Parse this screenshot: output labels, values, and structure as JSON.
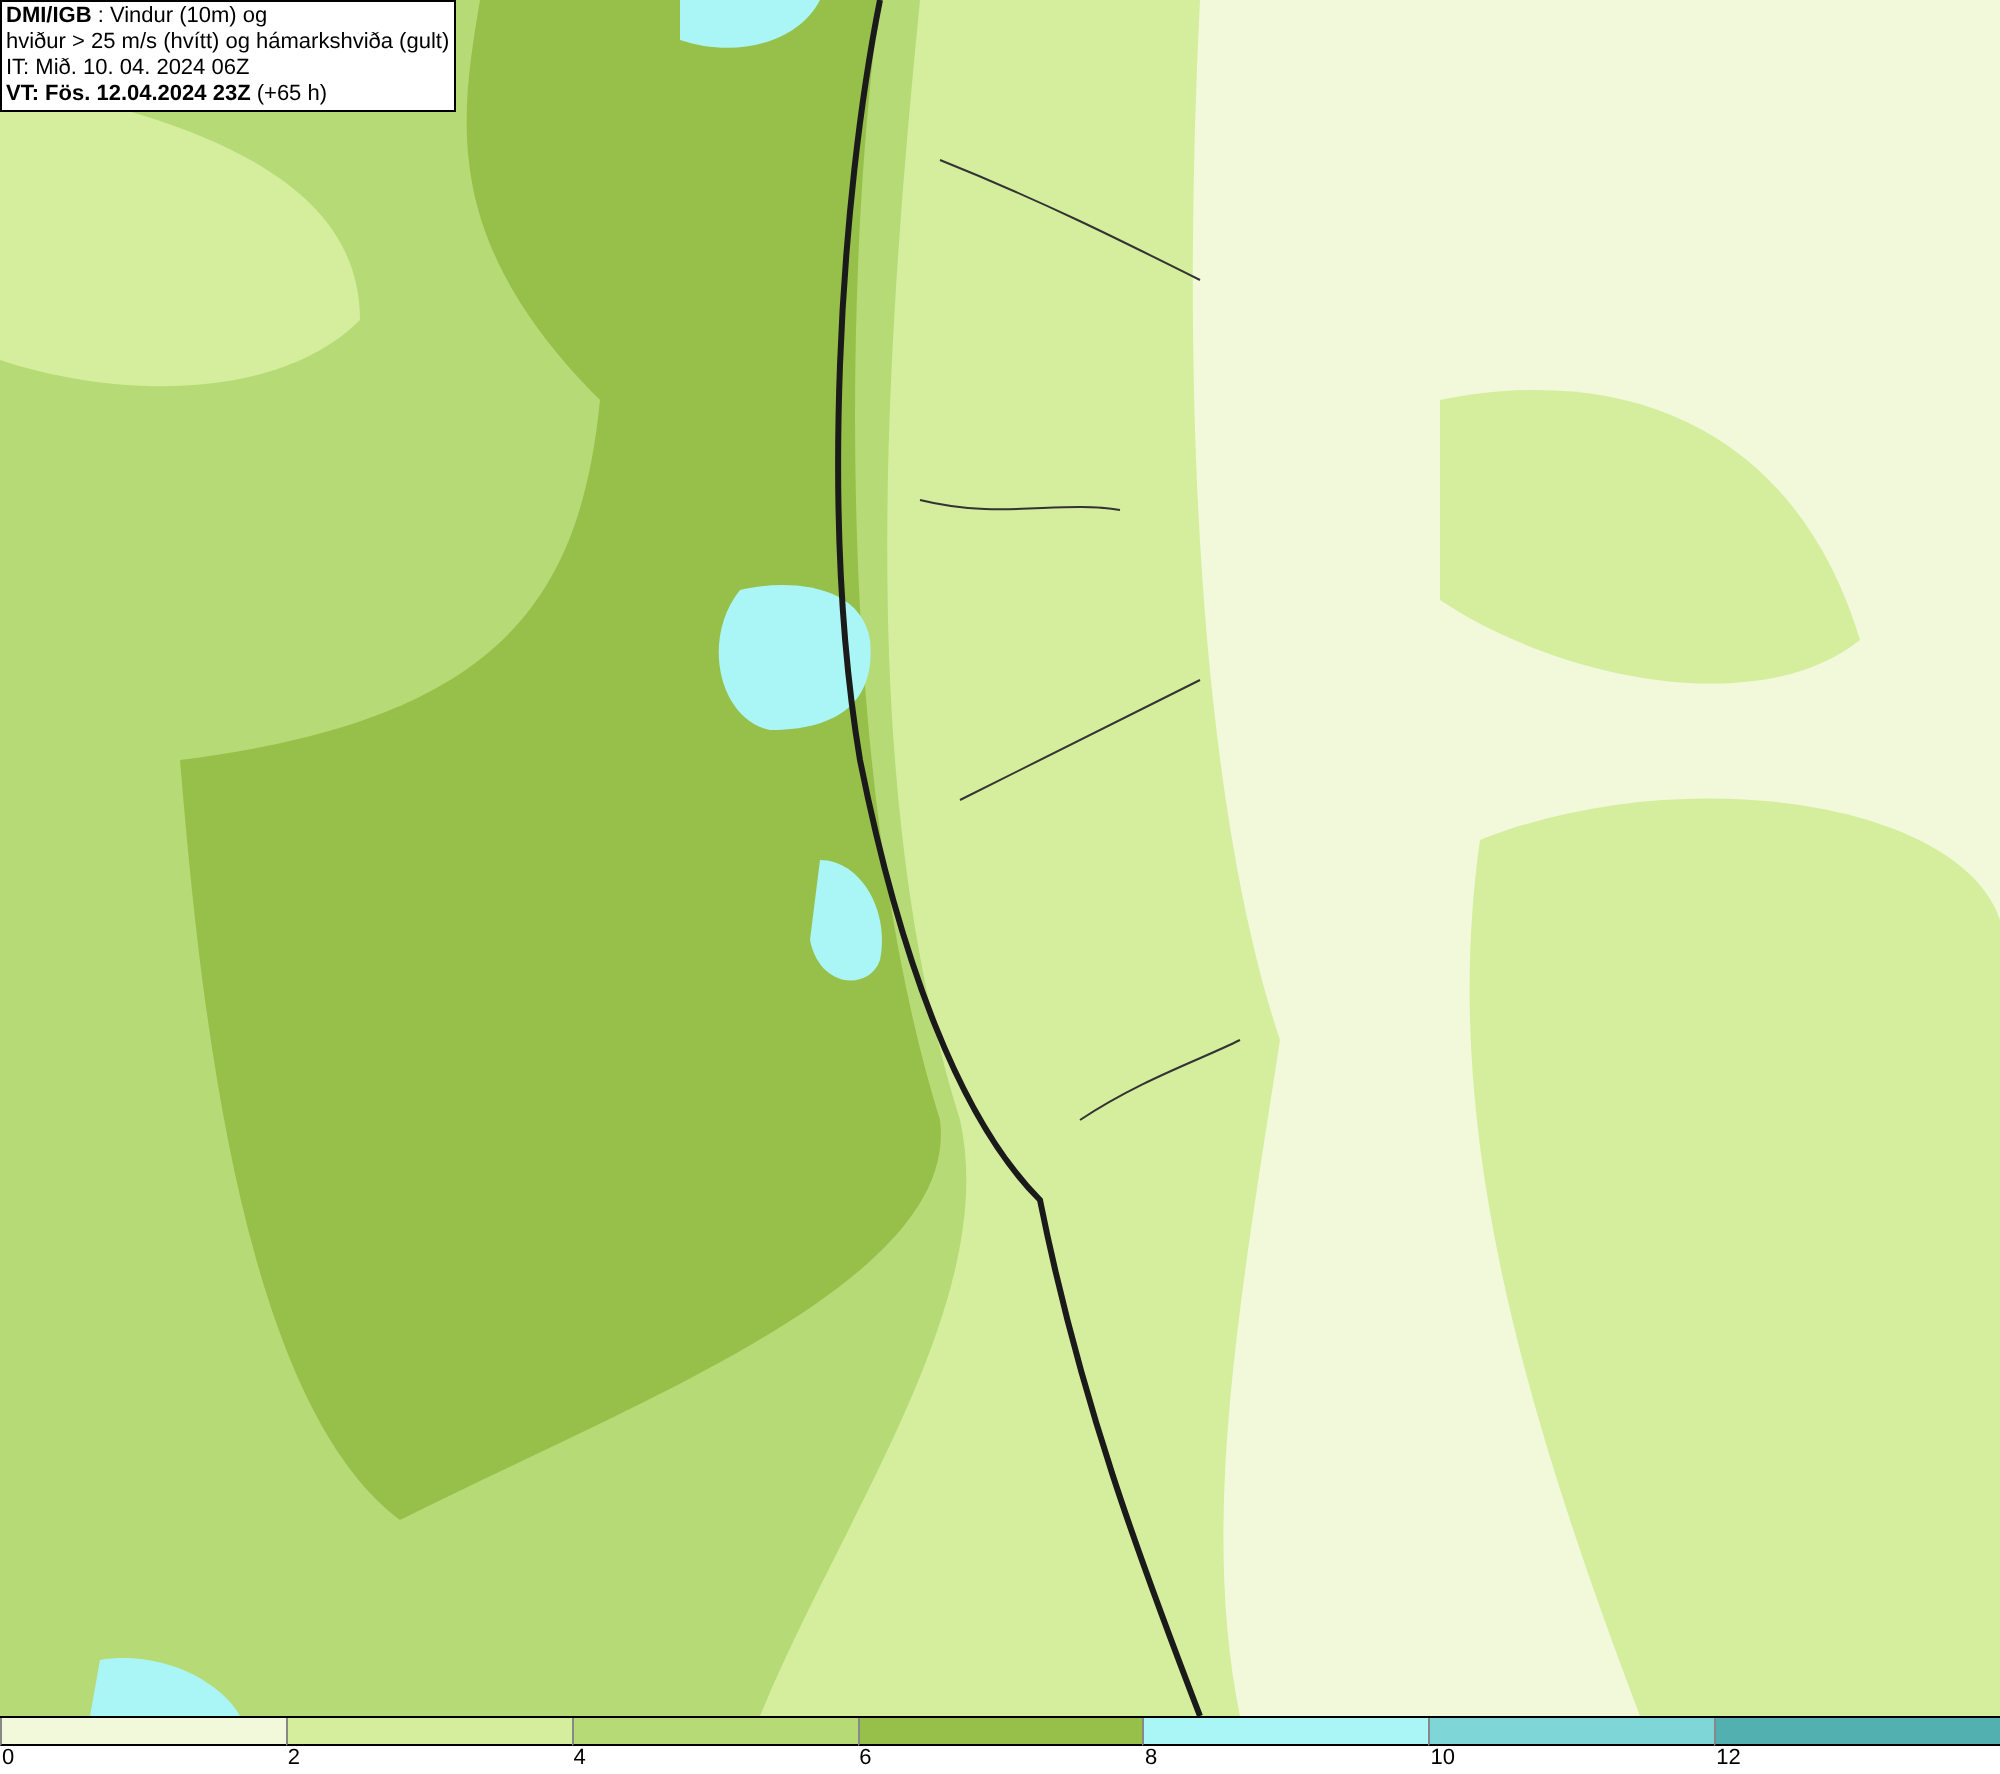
{
  "info_box": {
    "lines": [
      "**DMI/IGB** : Vindur (10m) og",
      "hviður > 25 m/s (hvítt) og hámarkshviða (gult)",
      "IT: Mið. 10. 04. 2024 06Z",
      "**VT: Fös. 12.04.2024 23Z** (+65 h)"
    ]
  },
  "legend": {
    "bands": [
      {
        "color": "#f2f9da",
        "label": "0"
      },
      {
        "color": "#d5ee9d",
        "label": "2"
      },
      {
        "color": "#b5da76",
        "label": "4"
      },
      {
        "color": "#96c04a",
        "label": "6"
      },
      {
        "color": "#aaf6f6",
        "label": "8"
      },
      {
        "color": "#7fd6d6",
        "label": "10"
      },
      {
        "color": "#52b0b0",
        "label": "12"
      }
    ]
  }
}
